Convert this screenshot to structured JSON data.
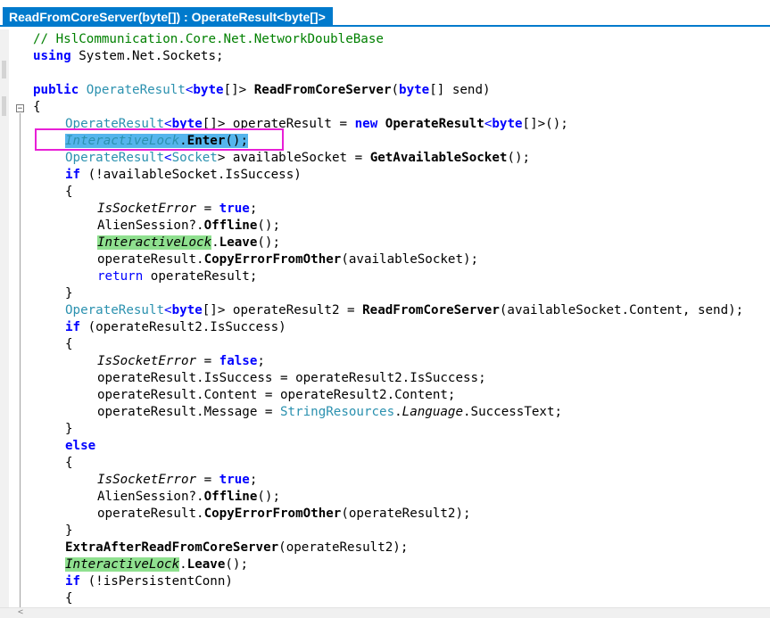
{
  "tab": {
    "title": "ReadFromCoreServer(byte[]) : OperateResult<byte[]>"
  },
  "code": {
    "l1": "// HslCommunication.Core.Net.NetworkDoubleBase",
    "l2_kw": "using",
    "l2_rest": " System.Net.Sockets;",
    "l4_public": "public",
    "l4_type": "OperateResult",
    "l4_lt": "<",
    "l4_byte": "byte",
    "l4_arr": "[]> ",
    "l4_method": "ReadFromCoreServer",
    "l4_po": "(",
    "l4_byte2": "byte",
    "l4_rest": "[] send)",
    "l5": "{",
    "l6_type": "OperateResult",
    "l6_lt": "<",
    "l6_byte": "byte",
    "l6_mid": "[]> operateResult = ",
    "l6_new": "new",
    "l6_sp": " ",
    "l6_type2": "OperateResult",
    "l6_lt2": "<",
    "l6_byte2": "byte",
    "l6_end": "[]>();",
    "l7_lock": "InteractiveLock",
    "l7_dot": ".",
    "l7_enter": "Enter",
    "l7_end": "();",
    "l8_type": "OperateResult",
    "l8_gen": "<",
    "l8_sock": "Socket",
    "l8_mid": "> availableSocket = ",
    "l8_call": "GetAvailableSocket",
    "l8_end": "();",
    "l9_if": "if",
    "l9_rest": " (!availableSocket.IsSuccess)",
    "l10": "{",
    "l11_v": "IsSocketError",
    "l11_eq": " = ",
    "l11_true": "true",
    "l11_end": ";",
    "l12_pre": "AlienSession?.",
    "l12_m": "Offline",
    "l12_end": "();",
    "l13_lock": "InteractiveLock",
    "l13_dot": ".",
    "l13_m": "Leave",
    "l13_end": "();",
    "l14_pre": "operateResult.",
    "l14_m": "CopyErrorFromOther",
    "l14_end": "(availableSocket);",
    "l15_ret": "return",
    "l15_rest": " operateResult;",
    "l16": "}",
    "l17_type": "OperateResult",
    "l17_lt": "<",
    "l17_byte": "byte",
    "l17_mid": "[]> operateResult2 = ",
    "l17_call": "ReadFromCoreServer",
    "l17_end": "(availableSocket.Content, send);",
    "l18_if": "if",
    "l18_rest": " (operateResult2.IsSuccess)",
    "l19": "{",
    "l20_v": "IsSocketError",
    "l20_eq": " = ",
    "l20_false": "false",
    "l20_end": ";",
    "l21": "operateResult.IsSuccess = operateResult2.IsSuccess;",
    "l22": "operateResult.Content = operateResult2.Content;",
    "l23_pre": "operateResult.Message = ",
    "l23_type": "StringResources",
    "l23_dot": ".",
    "l23_lang": "Language",
    "l23_end": ".SuccessText;",
    "l24": "}",
    "l25_else": "else",
    "l26": "{",
    "l27_v": "IsSocketError",
    "l27_eq": " = ",
    "l27_true": "true",
    "l27_end": ";",
    "l28_pre": "AlienSession?.",
    "l28_m": "Offline",
    "l28_end": "();",
    "l29_pre": "operateResult.",
    "l29_m": "CopyErrorFromOther",
    "l29_end": "(operateResult2);",
    "l30": "}",
    "l31_m": "ExtraAfterReadFromCoreServer",
    "l31_end": "(operateResult2);",
    "l32_lock": "InteractiveLock",
    "l32_dot": ".",
    "l32_m": "Leave",
    "l32_end": "();",
    "l33_if": "if",
    "l33_rest": " (!isPersistentConn)",
    "l34": "{"
  },
  "colors": {
    "tab_bg": "#007acc",
    "keyword": "#0000ff",
    "type": "#2b91af",
    "comment": "#008000",
    "selection": "#55b5ec",
    "reference_highlight": "#8fe08f",
    "annotation_box": "#e81fd6"
  },
  "icons": {
    "fold": "collapse-minus-icon",
    "scroll": "scroll-left-arrow-icon"
  },
  "fold_glyph": "−",
  "scroll_glyph": "<"
}
